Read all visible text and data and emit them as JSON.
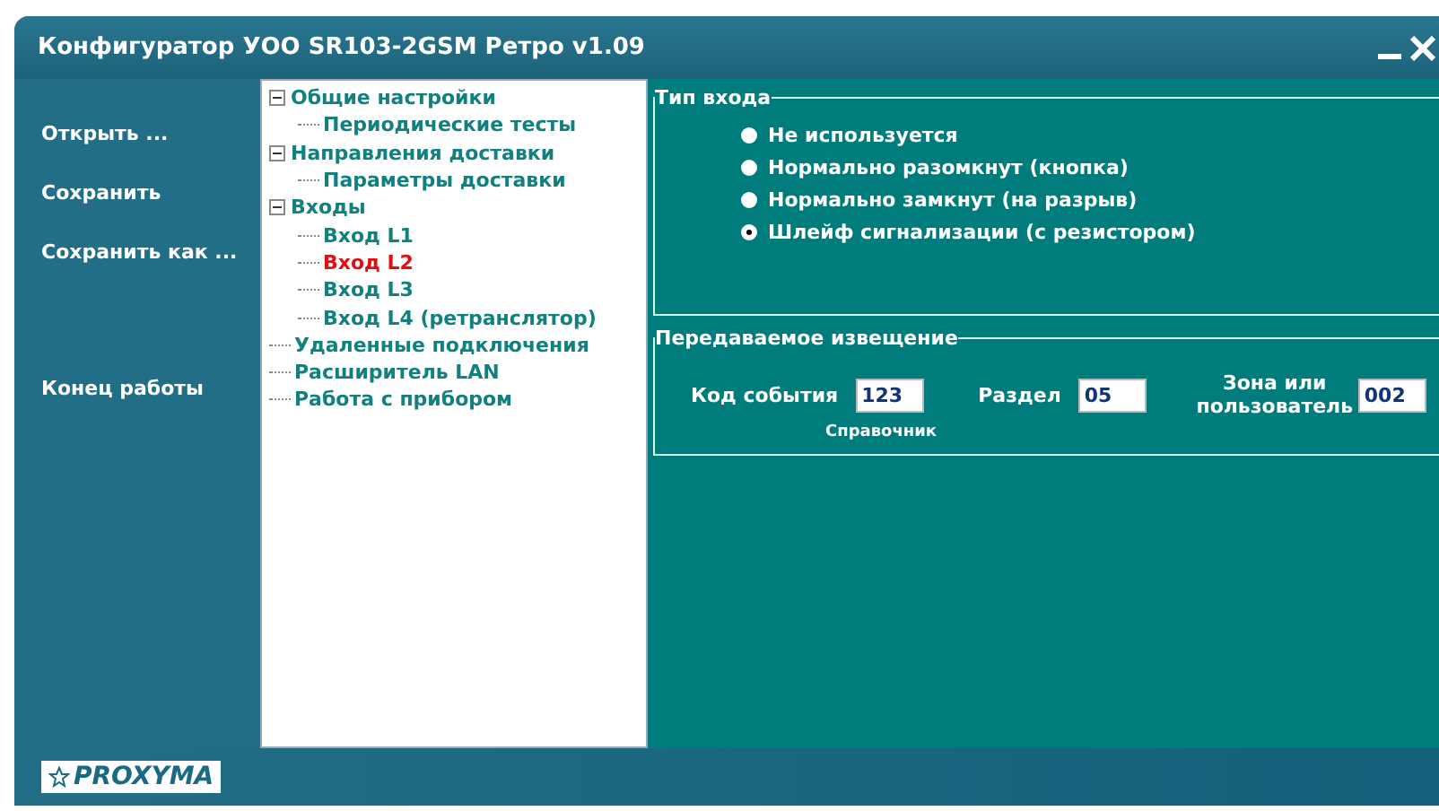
{
  "window": {
    "title": "Конфигуратор УОО SR103-2GSM Ретро v1.09"
  },
  "sidebar": {
    "items": [
      {
        "label": "Открыть ..."
      },
      {
        "label": "Сохранить"
      },
      {
        "label": "Сохранить как ..."
      },
      {
        "label": "Конец  работы"
      }
    ]
  },
  "tree": [
    {
      "label": "Общие настройки",
      "expanded": true,
      "selected": false,
      "children": [
        {
          "label": "Периодические тесты",
          "selected": false
        }
      ]
    },
    {
      "label": "Направления доставки",
      "expanded": true,
      "selected": false,
      "children": [
        {
          "label": "Параметры доставки",
          "selected": false
        }
      ]
    },
    {
      "label": "Входы",
      "expanded": true,
      "selected": false,
      "children": [
        {
          "label": "Вход L1",
          "selected": false
        },
        {
          "label": "Вход L2",
          "selected": true
        },
        {
          "label": "Вход L3",
          "selected": false
        },
        {
          "label": "Вход L4 (ретранслятор)",
          "selected": false
        }
      ]
    },
    {
      "label": "Удаленные подключения",
      "selected": false
    },
    {
      "label": "Расширитель LAN",
      "selected": false
    },
    {
      "label": "Работа с прибором",
      "selected": false
    }
  ],
  "input_type": {
    "title": "Тип входа",
    "options": [
      {
        "label": "Не используется",
        "selected": false
      },
      {
        "label": "Нормально разомкнут (кнопка)",
        "selected": false
      },
      {
        "label": "Нормально замкнут (на разрыв)",
        "selected": false
      },
      {
        "label": "Шлейф сигнализации (с резистором)",
        "selected": true
      }
    ]
  },
  "notification": {
    "title": "Передаваемое извещение",
    "event_code": {
      "label": "Код события",
      "value": "123",
      "link": "Справочник"
    },
    "partition": {
      "label": "Раздел",
      "value": "05"
    },
    "zone": {
      "label": "Зона или пользователь",
      "value": "002"
    }
  },
  "footer": {
    "logo": "PROXYMA"
  }
}
